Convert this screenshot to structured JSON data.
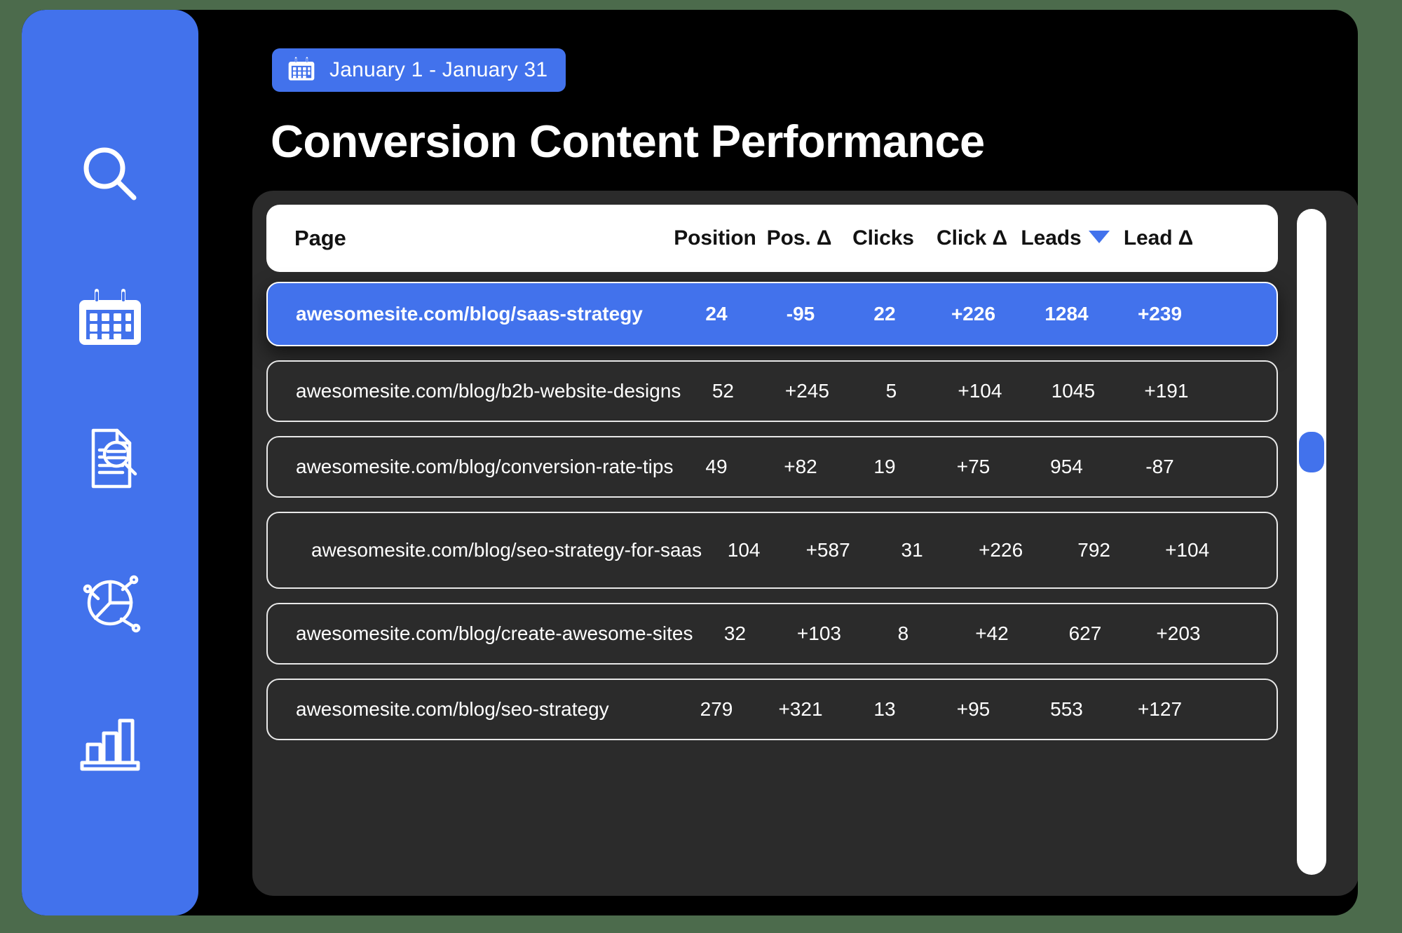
{
  "theme": {
    "accent": "#4272ec",
    "panel_bg": "#2b2b2b",
    "frame_bg": "#000000",
    "page_bg": "#4c6b4c",
    "header_bg": "#ffffff",
    "text_light": "#ffffff",
    "text_dark": "#121212"
  },
  "sidebar": {
    "items": [
      {
        "name": "search",
        "icon": "search-icon"
      },
      {
        "name": "calendar",
        "icon": "calendar-icon"
      },
      {
        "name": "document-audit",
        "icon": "document-search-icon"
      },
      {
        "name": "analytics",
        "icon": "pie-chart-icon"
      },
      {
        "name": "reports",
        "icon": "bar-chart-icon"
      }
    ]
  },
  "header": {
    "date_range": "January 1 - January 31",
    "date_icon": "calendar-icon",
    "title": "Conversion Content Performance"
  },
  "table": {
    "columns": [
      {
        "key": "page",
        "label": "Page",
        "align": "left"
      },
      {
        "key": "position",
        "label": "Position",
        "align": "center"
      },
      {
        "key": "pos_d",
        "label": "Pos. Δ",
        "align": "center"
      },
      {
        "key": "clicks",
        "label": "Clicks",
        "align": "center"
      },
      {
        "key": "click_d",
        "label": "Click Δ",
        "align": "center"
      },
      {
        "key": "leads",
        "label": "Leads",
        "align": "center",
        "sorted": "desc",
        "sort_icon": "caret-down-icon"
      },
      {
        "key": "lead_d",
        "label": "Lead Δ",
        "align": "center"
      }
    ],
    "rows": [
      {
        "page": "awesomesite.com/blog/saas-strategy",
        "position": "24",
        "pos_d": "-95",
        "clicks": "22",
        "click_d": "+226",
        "leads": "1284",
        "lead_d": "+239",
        "selected": true,
        "tall": false
      },
      {
        "page": "awesomesite.com/blog/b2b-website-designs",
        "position": "52",
        "pos_d": "+245",
        "clicks": "5",
        "click_d": "+104",
        "leads": "1045",
        "lead_d": "+191",
        "selected": false,
        "tall": false
      },
      {
        "page": "awesomesite.com/blog/conversion-rate-tips",
        "position": "49",
        "pos_d": "+82",
        "clicks": "19",
        "click_d": "+75",
        "leads": "954",
        "lead_d": "-87",
        "selected": false,
        "tall": false
      },
      {
        "page": "awesomesite.com/blog/seo-strategy-for-saas",
        "position": "104",
        "pos_d": "+587",
        "clicks": "31",
        "click_d": "+226",
        "leads": "792",
        "lead_d": "+104",
        "selected": false,
        "tall": true
      },
      {
        "page": "awesomesite.com/blog/create-awesome-sites",
        "position": "32",
        "pos_d": "+103",
        "clicks": "8",
        "click_d": "+42",
        "leads": "627",
        "lead_d": "+203",
        "selected": false,
        "tall": false
      },
      {
        "page": "awesomesite.com/blog/seo-strategy",
        "position": "279",
        "pos_d": "+321",
        "clicks": "13",
        "click_d": "+95",
        "leads": "553",
        "lead_d": "+127",
        "selected": false,
        "tall": false
      }
    ]
  },
  "scrollbar": {
    "orientation": "vertical",
    "thumb_position_pct": 33
  }
}
